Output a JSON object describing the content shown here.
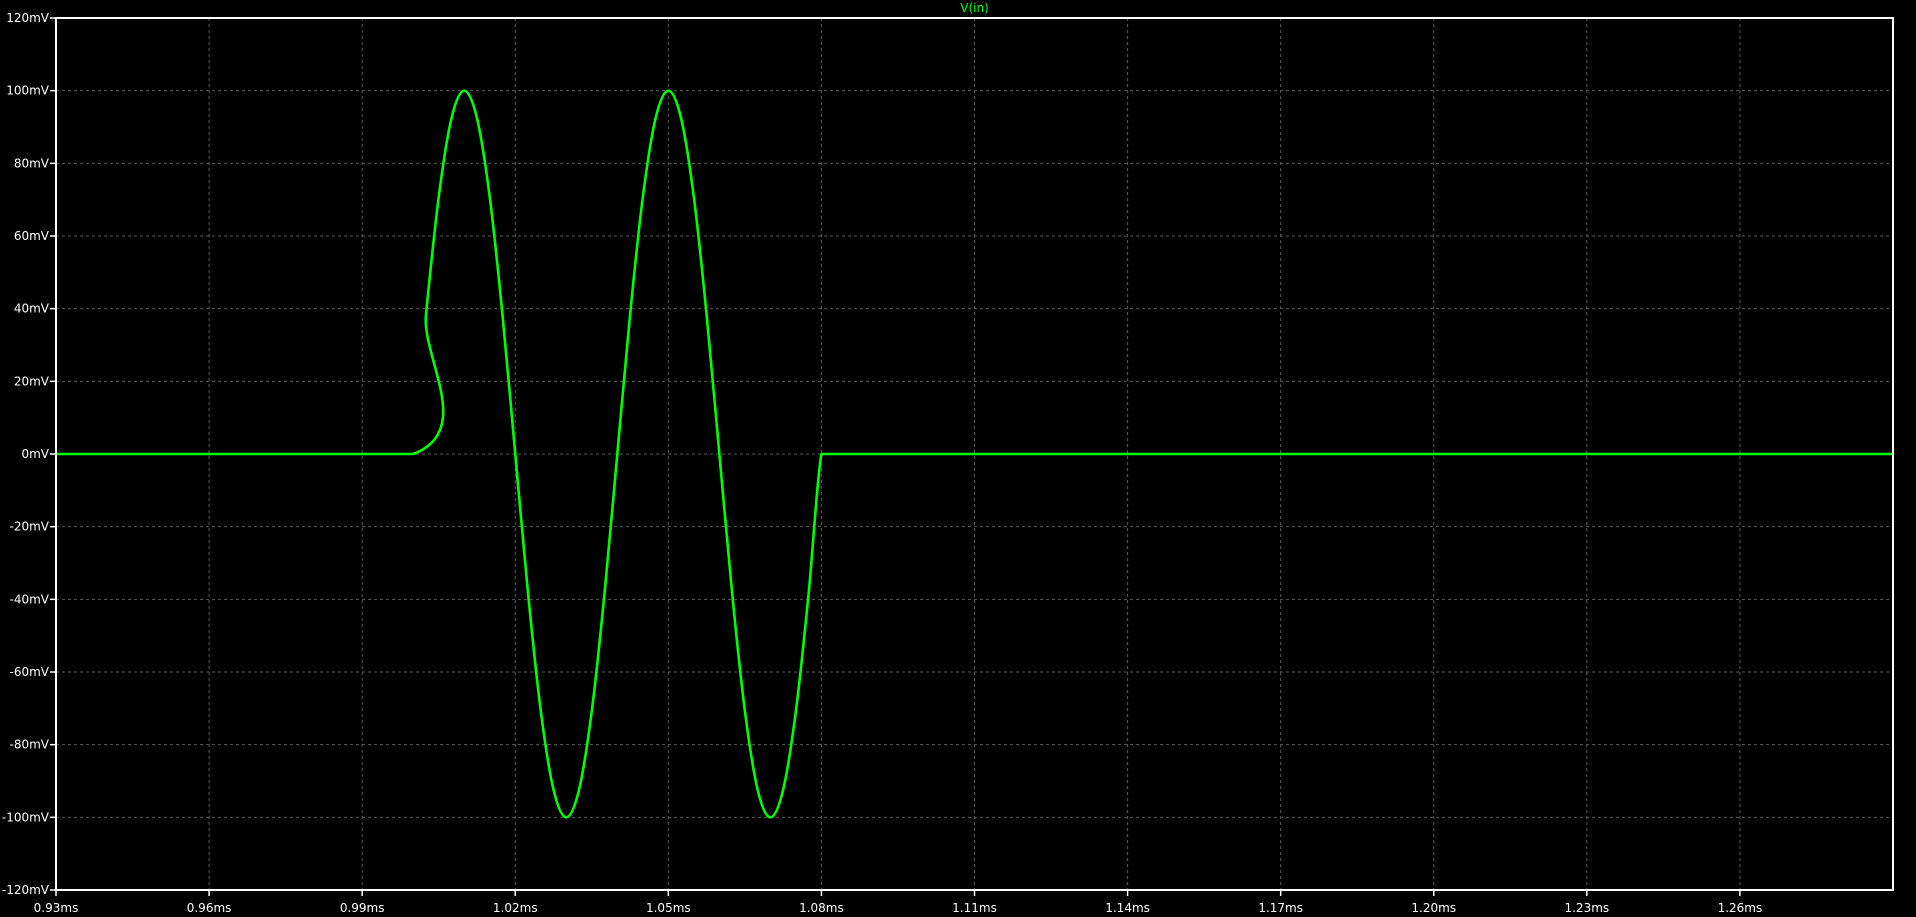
{
  "colors": {
    "background": "#000000",
    "frame": "#ffffff",
    "grid": "#5a5a5a",
    "trace": "#00ff00",
    "text": "#ffffff"
  },
  "chart_data": {
    "type": "line",
    "title": "",
    "xlabel": "",
    "ylabel": "",
    "xlim": [
      0.93,
      1.29
    ],
    "ylim": [
      -120,
      120
    ],
    "x_unit": "ms",
    "y_unit": "mV",
    "grid": true,
    "x_ticks": [
      0.93,
      0.96,
      0.99,
      1.02,
      1.05,
      1.08,
      1.11,
      1.14,
      1.17,
      1.2,
      1.23,
      1.26
    ],
    "x_tick_labels": [
      "0.93ms",
      "0.96ms",
      "0.99ms",
      "1.02ms",
      "1.05ms",
      "1.08ms",
      "1.11ms",
      "1.14ms",
      "1.17ms",
      "1.20ms",
      "1.23ms",
      "1.26ms"
    ],
    "y_ticks": [
      120,
      100,
      80,
      60,
      40,
      20,
      0,
      -20,
      -40,
      -60,
      -80,
      -100,
      -120
    ],
    "y_tick_labels": [
      "120mV",
      "100mV",
      "80mV",
      "60mV",
      "40mV",
      "20mV",
      "0mV",
      "-20mV",
      "-40mV",
      "-60mV",
      "-80mV",
      "-100mV",
      "-120mV"
    ],
    "series": [
      {
        "name": "V(in)",
        "color": "#00ff00",
        "x": [
          0.93,
          1.0,
          1.0025,
          1.005,
          1.0075,
          1.01,
          1.0125,
          1.015,
          1.0175,
          1.02,
          1.0225,
          1.025,
          1.0275,
          1.03,
          1.0325,
          1.035,
          1.0375,
          1.04,
          1.0425,
          1.045,
          1.0475,
          1.05,
          1.0525,
          1.055,
          1.0575,
          1.06,
          1.0625,
          1.065,
          1.0675,
          1.07,
          1.0725,
          1.075,
          1.0775,
          1.08,
          1.0825,
          1.085,
          1.0875,
          1.09,
          1.0925,
          1.095,
          1.0975,
          1.1,
          1.29
        ],
        "y": [
          0,
          0,
          38.3,
          70.7,
          92.4,
          100,
          92.4,
          70.7,
          38.3,
          0,
          -38.3,
          -70.7,
          -92.4,
          -100,
          -92.4,
          -70.7,
          -38.3,
          0,
          38.3,
          70.7,
          92.4,
          100,
          92.4,
          70.7,
          38.3,
          0,
          -38.3,
          -70.7,
          -92.4,
          -100,
          -92.4,
          -70.7,
          -38.3,
          0,
          0,
          0,
          0,
          0,
          0,
          0,
          0,
          0,
          0
        ]
      }
    ]
  }
}
